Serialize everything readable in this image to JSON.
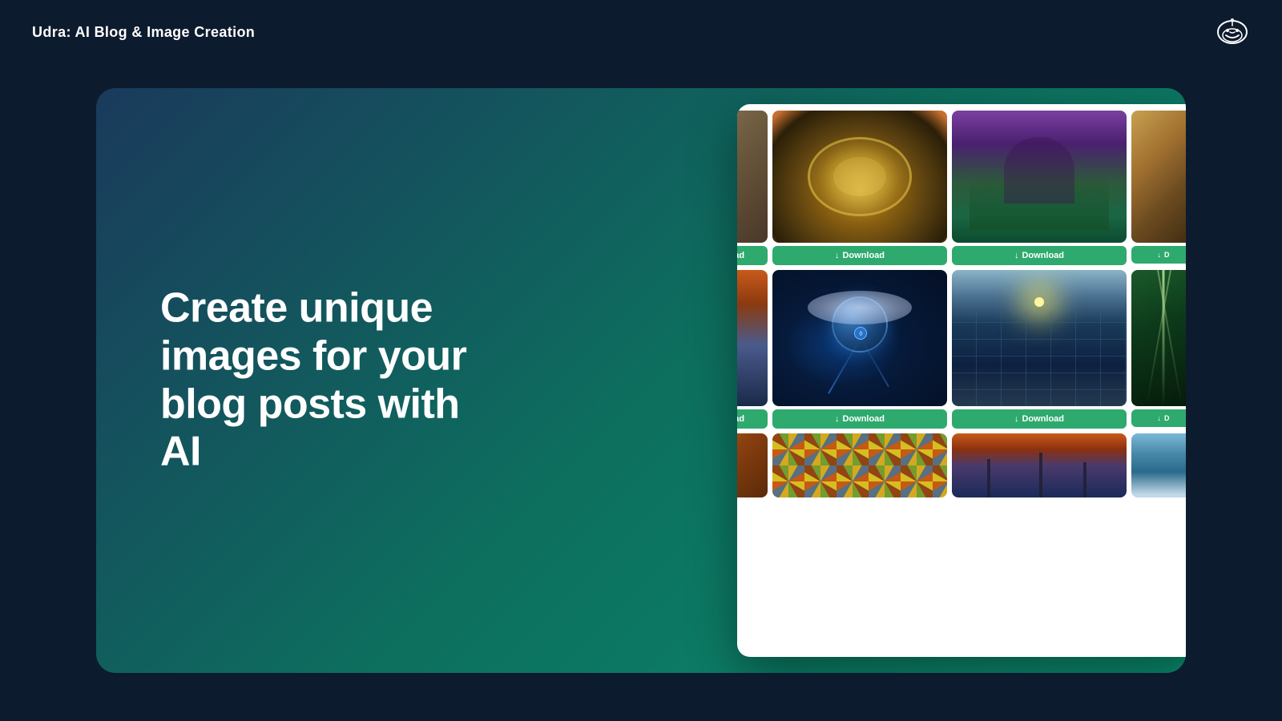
{
  "app": {
    "title": "Udra: AI Blog & Image Creation"
  },
  "hero": {
    "heading": "Create unique images for your blog posts with AI"
  },
  "gallery": {
    "download_label": "Download",
    "rows": [
      {
        "cells": [
          {
            "id": "img-bed",
            "type": "bed",
            "show_download": true,
            "download_label": "load"
          },
          {
            "id": "img-jewelry",
            "type": "jewelry",
            "show_download": true,
            "download_label": "Download"
          },
          {
            "id": "img-landscape",
            "type": "landscape",
            "show_download": true,
            "download_label": "Download"
          },
          {
            "id": "img-desert",
            "type": "desert",
            "show_download": true,
            "download_label": "D"
          }
        ]
      },
      {
        "cells": [
          {
            "id": "img-sunset-mountain",
            "type": "sunset-mountain",
            "show_download": true,
            "download_label": "load"
          },
          {
            "id": "img-earth-cloud",
            "type": "earth-cloud",
            "show_download": true,
            "download_label": "Download"
          },
          {
            "id": "img-solar",
            "type": "solar",
            "show_download": true,
            "download_label": "Download"
          },
          {
            "id": "img-forest-rays",
            "type": "forest-rays",
            "show_download": true,
            "download_label": "D"
          }
        ]
      },
      {
        "cells": [
          {
            "id": "img-extra1",
            "type": "extra1",
            "show_download": false
          },
          {
            "id": "img-mosaic",
            "type": "mosaic",
            "show_download": false
          },
          {
            "id": "img-windmill",
            "type": "windmill",
            "show_download": false
          },
          {
            "id": "img-blue-sky",
            "type": "blue-sky",
            "show_download": false
          }
        ]
      }
    ]
  },
  "icons": {
    "logo": "🤖",
    "download_arrow": "↓"
  }
}
